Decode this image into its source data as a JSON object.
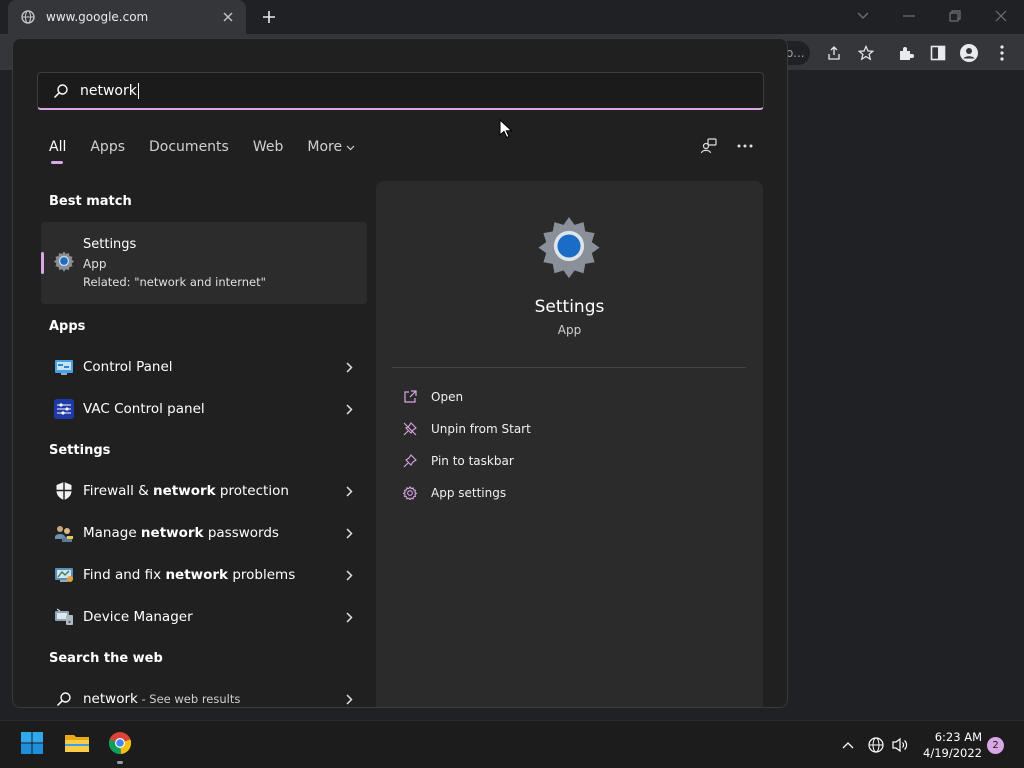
{
  "browser": {
    "tab_title": "www.google.com",
    "omnibox_tail": "o..."
  },
  "search": {
    "query": "network"
  },
  "filters": [
    {
      "label": "All"
    },
    {
      "label": "Apps"
    },
    {
      "label": "Documents"
    },
    {
      "label": "Web"
    },
    {
      "label": "More"
    }
  ],
  "best_match": {
    "heading": "Best match",
    "title": "Settings",
    "type": "App",
    "related": "Related: \"network and internet\""
  },
  "apps": {
    "heading": "Apps",
    "items": [
      {
        "label": "Control Panel"
      },
      {
        "label": "VAC Control panel"
      }
    ]
  },
  "settings": {
    "heading": "Settings",
    "items": [
      {
        "pre": "Firewall & ",
        "bold": "network",
        "post": " protection"
      },
      {
        "pre": "Manage ",
        "bold": "network",
        "post": " passwords"
      },
      {
        "pre": "Find and fix ",
        "bold": "network",
        "post": " problems"
      },
      {
        "pre": "Device Manager",
        "bold": "",
        "post": ""
      }
    ]
  },
  "web": {
    "heading": "Search the web",
    "query": "network",
    "suffix": " - See web results"
  },
  "preview": {
    "title": "Settings",
    "type": "App",
    "actions": [
      {
        "label": "Open"
      },
      {
        "label": "Unpin from Start"
      },
      {
        "label": "Pin to taskbar"
      },
      {
        "label": "App settings"
      }
    ]
  },
  "taskbar": {
    "time": "6:23 AM",
    "date": "4/19/2022",
    "notifications": "2"
  },
  "colors": {
    "accent": "#d9a7e6",
    "flyout_bg": "#202020",
    "preview_bg": "#2b2b2b"
  },
  "icons": [
    "globe-icon",
    "close-icon",
    "plus-icon",
    "chevron-down-icon",
    "minimize-icon",
    "restore-icon",
    "share-icon",
    "star-icon",
    "extensions-icon",
    "side-panel-icon",
    "profile-icon",
    "kebab-icon",
    "search-icon",
    "gear-icon",
    "control-panel-icon",
    "vac-icon",
    "shield-icon",
    "users-key-icon",
    "troubleshoot-icon",
    "device-manager-icon",
    "chevron-right-icon",
    "open-icon",
    "unpin-icon",
    "pin-icon",
    "windows-icon",
    "folder-icon",
    "chrome-icon",
    "up-arrow-icon",
    "network-icon",
    "volume-icon"
  ]
}
